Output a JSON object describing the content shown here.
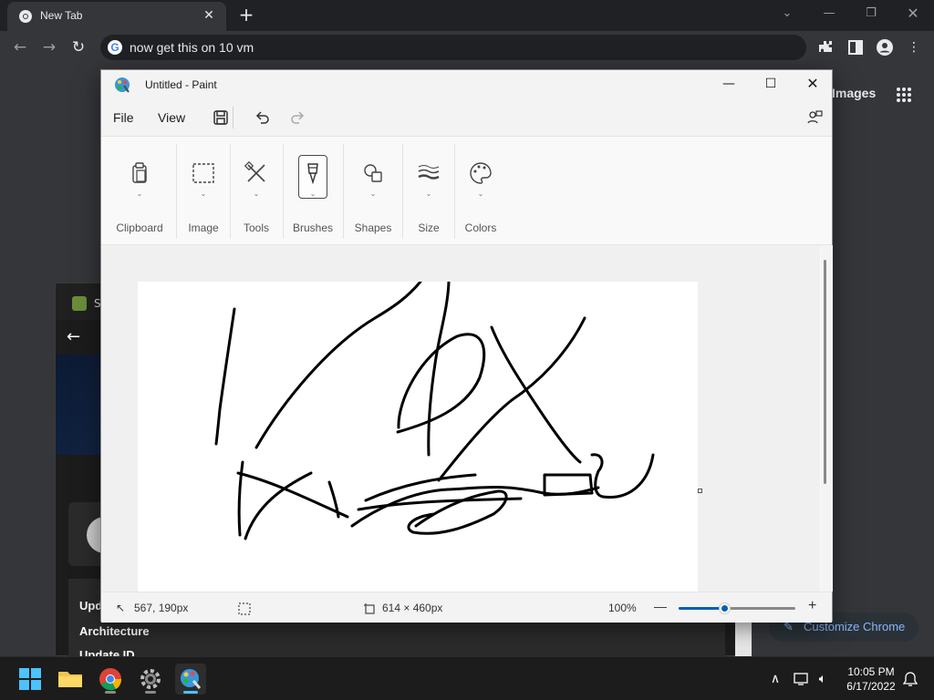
{
  "browser": {
    "tab_title": "New Tab",
    "omnibox_text": "now get this on 10 vm",
    "images_link": "Images",
    "customize_label": "Customize Chrome"
  },
  "settings_window": {
    "title_fragment": "S",
    "rows": [
      "Upd",
      "Architecture",
      "Update ID"
    ]
  },
  "paint": {
    "title": "Untitled - Paint",
    "menu": {
      "file": "File",
      "view": "View"
    },
    "ribbon": [
      "Clipboard",
      "Image",
      "Tools",
      "Brushes",
      "Shapes",
      "Size",
      "Colors"
    ],
    "status": {
      "cursor_pos": "567, 190px",
      "canvas_size": "614 × 460px",
      "zoom": "100%",
      "zoom_fraction": 0.4
    }
  },
  "taskbar": {
    "apps": [
      "windows-start",
      "file-explorer",
      "chrome",
      "settings",
      "paint"
    ],
    "time": "10:05 PM",
    "date": "6/17/2022"
  },
  "colors": {
    "chrome_dark": "#202124",
    "chrome_toolbar": "#35363a",
    "paint_accent": "#005fb8",
    "link_blue": "#8ab4f8",
    "taskbar_active": "#4cc2ff"
  }
}
